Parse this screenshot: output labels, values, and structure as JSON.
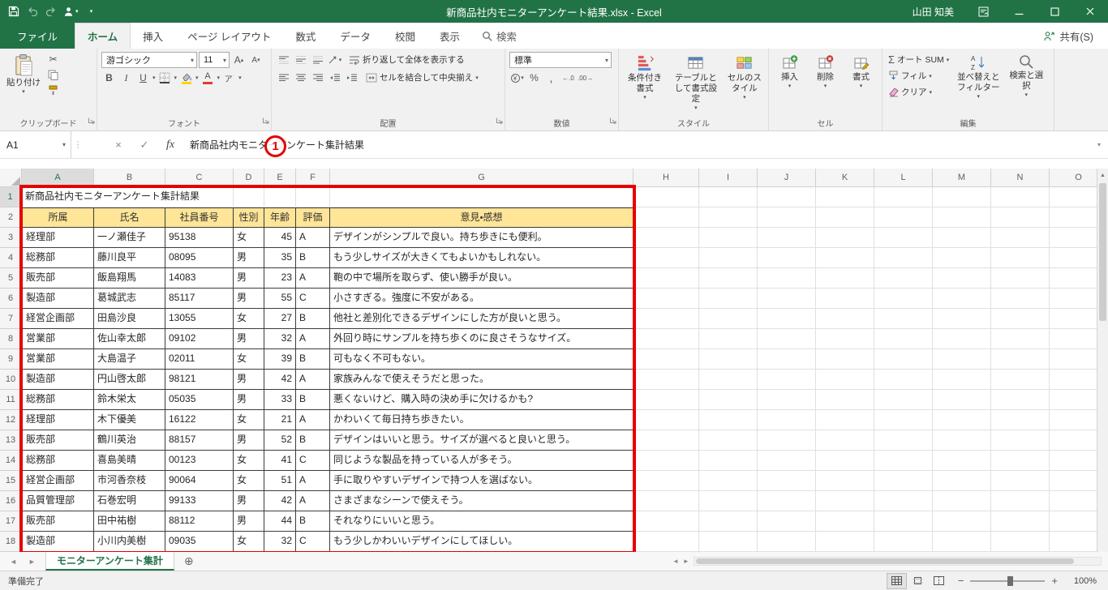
{
  "colors": {
    "excel_green": "#217346",
    "annotation_red": "#e60000",
    "table_header_fill": "#ffe598"
  },
  "title_bar": {
    "document_title": "新商品社内モニターアンケート結果.xlsx  -  Excel",
    "user_name": "山田 知美"
  },
  "ribbon_tabs": {
    "file": "ファイル",
    "tabs": [
      "ホーム",
      "挿入",
      "ページ レイアウト",
      "数式",
      "データ",
      "校閲",
      "表示"
    ],
    "tell_me": "検索",
    "share": "共有(S)"
  },
  "ribbon": {
    "clipboard": {
      "label": "クリップボード",
      "paste": "貼り付け"
    },
    "font": {
      "label": "フォント",
      "font_name": "游ゴシック",
      "font_size": "11"
    },
    "alignment": {
      "label": "配置",
      "wrap_text": "折り返して全体を表示する",
      "merge_center": "セルを結合して中央揃え"
    },
    "number": {
      "label": "数値",
      "format": "標準"
    },
    "styles": {
      "label": "スタイル",
      "conditional": "条件付き書式",
      "format_table": "テーブルとして書式設定",
      "cell_styles": "セルのスタイル"
    },
    "cells": {
      "label": "セル",
      "insert": "挿入",
      "delete": "削除",
      "format": "書式"
    },
    "editing": {
      "label": "編集",
      "autosum": "オート SUM",
      "fill": "フィル",
      "clear": "クリア",
      "sort": "並べ替えとフィルター",
      "find": "検索と選択"
    }
  },
  "formula_bar": {
    "name_box": "A1",
    "fx_label": "fx",
    "content": "新商品社内モニターアンケート集計結果"
  },
  "annotation": {
    "step_number": "1"
  },
  "grid": {
    "column_letters": [
      "A",
      "B",
      "C",
      "D",
      "E",
      "F",
      "G",
      "H",
      "I",
      "J",
      "K",
      "L",
      "M",
      "N",
      "O"
    ],
    "title_cell": "新商品社内モニターアンケート集計結果",
    "table_headers": [
      "所属",
      "氏名",
      "社員番号",
      "性別",
      "年齢",
      "評価",
      "意見・感想"
    ],
    "table_rows": [
      [
        "経理部",
        "一ノ瀬佳子",
        "95138",
        "女",
        "45",
        "A",
        "デザインがシンプルで良い。持ち歩きにも便利。"
      ],
      [
        "総務部",
        "藤川良平",
        "08095",
        "男",
        "35",
        "B",
        "もう少しサイズが大きくてもよいかもしれない。"
      ],
      [
        "販売部",
        "飯島翔馬",
        "14083",
        "男",
        "23",
        "A",
        "鞄の中で場所を取らず、使い勝手が良い。"
      ],
      [
        "製造部",
        "葛城武志",
        "85117",
        "男",
        "55",
        "C",
        "小さすぎる。強度に不安がある。"
      ],
      [
        "経営企画部",
        "田島沙良",
        "13055",
        "女",
        "27",
        "B",
        "他社と差別化できるデザインにした方が良いと思う。"
      ],
      [
        "営業部",
        "佐山幸太郎",
        "09102",
        "男",
        "32",
        "A",
        "外回り時にサンプルを持ち歩くのに良さそうなサイズ。"
      ],
      [
        "営業部",
        "大島温子",
        "02011",
        "女",
        "39",
        "B",
        "可もなく不可もない。"
      ],
      [
        "製造部",
        "円山啓太郎",
        "98121",
        "男",
        "42",
        "A",
        "家族みんなで使えそうだと思った。"
      ],
      [
        "総務部",
        "鈴木栄太",
        "05035",
        "男",
        "33",
        "B",
        "悪くないけど、購入時の決め手に欠けるかも?"
      ],
      [
        "経理部",
        "木下優美",
        "16122",
        "女",
        "21",
        "A",
        "かわいくて毎日持ち歩きたい。"
      ],
      [
        "販売部",
        "鶴川英治",
        "88157",
        "男",
        "52",
        "B",
        "デザインはいいと思う。サイズが選べると良いと思う。"
      ],
      [
        "総務部",
        "喜島美晴",
        "00123",
        "女",
        "41",
        "C",
        "同じような製品を持っている人が多そう。"
      ],
      [
        "経営企画部",
        "市河香奈枝",
        "90064",
        "女",
        "51",
        "A",
        "手に取りやすいデザインで持つ人を選ばない。"
      ],
      [
        "品質管理部",
        "石巻宏明",
        "99133",
        "男",
        "42",
        "A",
        "さまざまなシーンで使えそう。"
      ],
      [
        "販売部",
        "田中祐樹",
        "88112",
        "男",
        "44",
        "B",
        "それなりにいいと思う。"
      ],
      [
        "製造部",
        "小川内美樹",
        "09035",
        "女",
        "32",
        "C",
        "もう少しかわいいデザインにしてほしい。"
      ]
    ]
  },
  "sheet_tabs": {
    "active_sheet": "モニターアンケート集計"
  },
  "status_bar": {
    "ready": "準備完了",
    "zoom": "100%"
  }
}
